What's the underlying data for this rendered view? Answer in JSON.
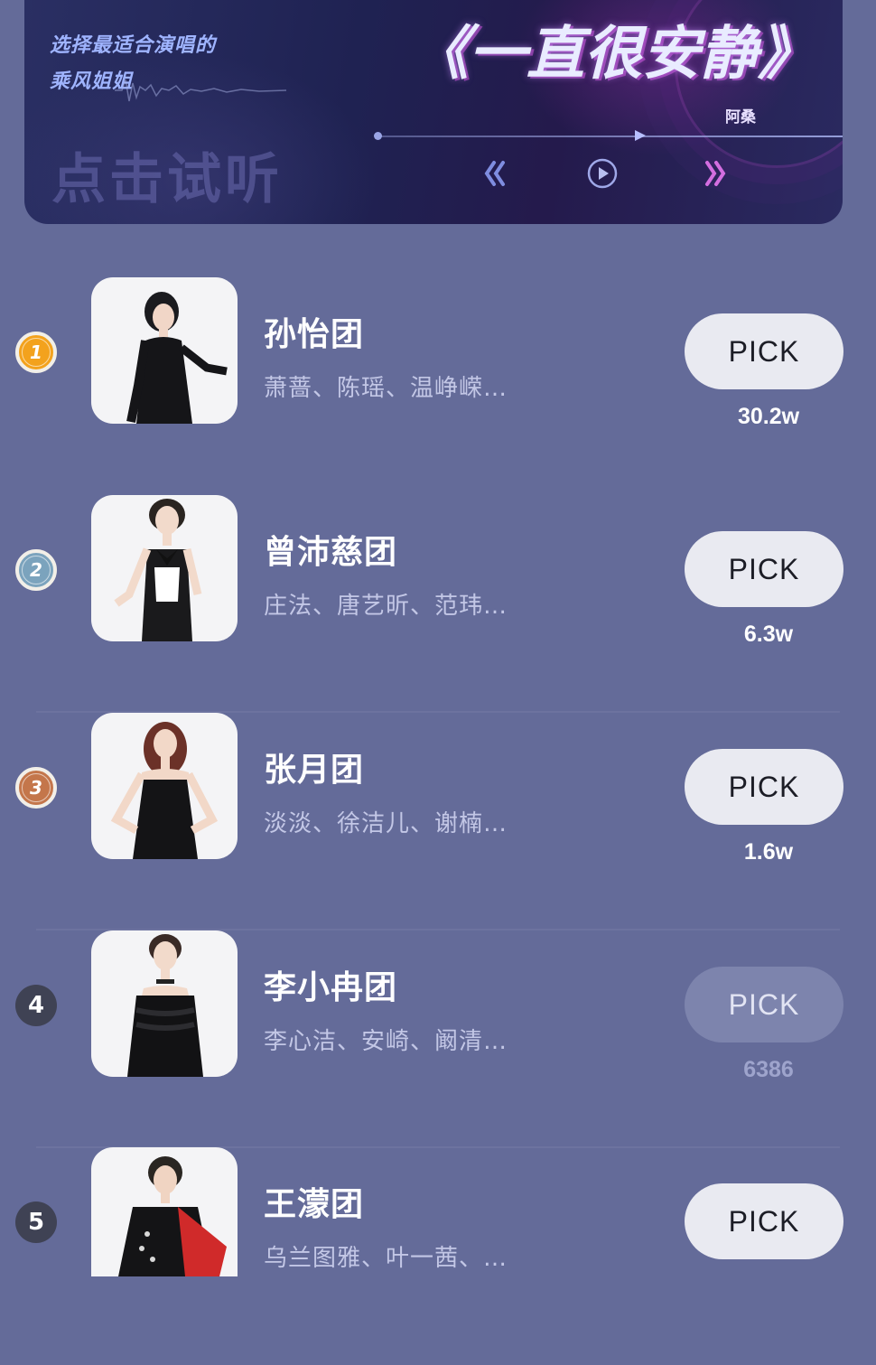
{
  "banner": {
    "subtitle_line1": "选择最适合演唱的",
    "subtitle_line2": "乘风姐姐",
    "listen_text": "点击试听",
    "song_title": "《一直很安静》",
    "singer": "阿桑",
    "controls": [
      "previous-icon",
      "play-icon",
      "next-icon"
    ]
  },
  "teams": [
    {
      "rank": "1",
      "rank_style": "gold",
      "name": "孙怡团",
      "members": "萧蔷、陈瑶、温峥嵘…",
      "pick_label": "PICK",
      "votes": "30.2w",
      "enabled": true
    },
    {
      "rank": "2",
      "rank_style": "silver",
      "name": "曾沛慈团",
      "members": "庄法、唐艺昕、范玮…",
      "pick_label": "PICK",
      "votes": "6.3w",
      "enabled": true
    },
    {
      "rank": "3",
      "rank_style": "bronze",
      "name": "张月团",
      "members": "淡淡、徐洁儿、谢楠…",
      "pick_label": "PICK",
      "votes": "1.6w",
      "enabled": true
    },
    {
      "rank": "4",
      "rank_style": "plain",
      "name": "李小冉团",
      "members": "李心洁、安崎、阚清…",
      "pick_label": "PICK",
      "votes": "6386",
      "enabled": false
    },
    {
      "rank": "5",
      "rank_style": "plain",
      "name": "王濛团",
      "members": "乌兰图雅、叶一茜、…",
      "pick_label": "PICK",
      "votes": "",
      "enabled": true
    }
  ],
  "colors": {
    "background": "#646b99",
    "rank_gold": "#f3a21d",
    "rank_silver": "#7ba3bd",
    "rank_bronze": "#c4764b",
    "rank_plain": "#3f4254",
    "pick_button": "#e9eaf1",
    "pick_button_disabled": "#7d84ad"
  }
}
